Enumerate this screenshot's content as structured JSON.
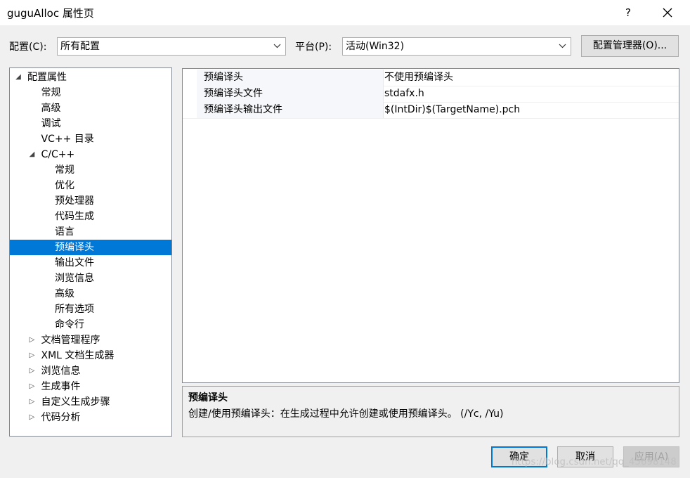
{
  "window": {
    "title": "guguAlloc 属性页",
    "help_label": "?",
    "close_icon": "close-icon"
  },
  "config_row": {
    "config_label": "配置(C):",
    "config_value": "所有配置",
    "platform_label": "平台(P):",
    "platform_value": "活动(Win32)",
    "manager_button": "配置管理器(O)..."
  },
  "tree": {
    "items": [
      {
        "label": "配置属性",
        "expander": "expanded"
      },
      {
        "label": "常规",
        "expander": "none"
      },
      {
        "label": "高级",
        "expander": "none"
      },
      {
        "label": "调试",
        "expander": "none"
      },
      {
        "label": "VC++ 目录",
        "expander": "none"
      },
      {
        "label": "C/C++",
        "expander": "expanded"
      },
      {
        "label": "常规",
        "expander": "none"
      },
      {
        "label": "优化",
        "expander": "none"
      },
      {
        "label": "预处理器",
        "expander": "none"
      },
      {
        "label": "代码生成",
        "expander": "none"
      },
      {
        "label": "语言",
        "expander": "none"
      },
      {
        "label": "预编译头",
        "expander": "none",
        "selected": true
      },
      {
        "label": "输出文件",
        "expander": "none"
      },
      {
        "label": "浏览信息",
        "expander": "none"
      },
      {
        "label": "高级",
        "expander": "none"
      },
      {
        "label": "所有选项",
        "expander": "none"
      },
      {
        "label": "命令行",
        "expander": "none"
      },
      {
        "label": "文档管理程序",
        "expander": "collapsed"
      },
      {
        "label": "XML 文档生成器",
        "expander": "collapsed"
      },
      {
        "label": "浏览信息",
        "expander": "collapsed"
      },
      {
        "label": "生成事件",
        "expander": "collapsed"
      },
      {
        "label": "自定义生成步骤",
        "expander": "collapsed"
      },
      {
        "label": "代码分析",
        "expander": "collapsed"
      }
    ]
  },
  "properties": [
    {
      "name": "预编译头",
      "value": "不使用预编译头"
    },
    {
      "name": "预编译头文件",
      "value": "stdafx.h"
    },
    {
      "name": "预编译头输出文件",
      "value": "$(IntDir)$(TargetName).pch"
    }
  ],
  "description": {
    "title": "预编译头",
    "text": "创建/使用预编译头：在生成过程中允许创建或使用预编译头。     (/Yc, /Yu)"
  },
  "buttons": {
    "ok": "确定",
    "cancel": "取消",
    "apply": "应用(A)"
  },
  "watermark": "https://blog.csdn.net/qq_45698148",
  "colors": {
    "selection": "#0078d7",
    "dialog_bg": "#f0f0f0"
  }
}
